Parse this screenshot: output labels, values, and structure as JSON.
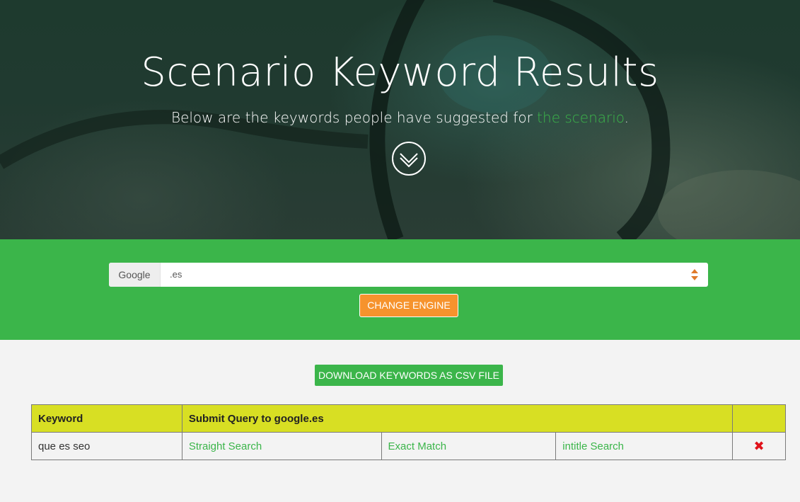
{
  "hero": {
    "title": "Scenario Keyword Results",
    "subtitle_prefix": "Below are the keywords people have suggested for ",
    "subtitle_link": "the scenario",
    "subtitle_suffix": ".",
    "scroll_icon": "chevron-double-down-icon"
  },
  "engine": {
    "label": "Google",
    "selected_value": ".es",
    "change_button": "CHANGE ENGINE"
  },
  "download_button": "DOWNLOAD KEYWORDS AS CSV FILE",
  "table": {
    "headers": {
      "keyword": "Keyword",
      "query_prefix": "Submit Query to ",
      "query_domain": "google.es"
    },
    "rows": [
      {
        "keyword": "que es seo",
        "straight": "Straight Search",
        "exact": "Exact Match",
        "intitle": "intitle Search",
        "delete_icon": "✖"
      }
    ]
  },
  "colors": {
    "accent_green": "#3bb54a",
    "orange": "#f6932d",
    "header_yellow": "#d8df23",
    "delete_red": "#e0121a"
  }
}
